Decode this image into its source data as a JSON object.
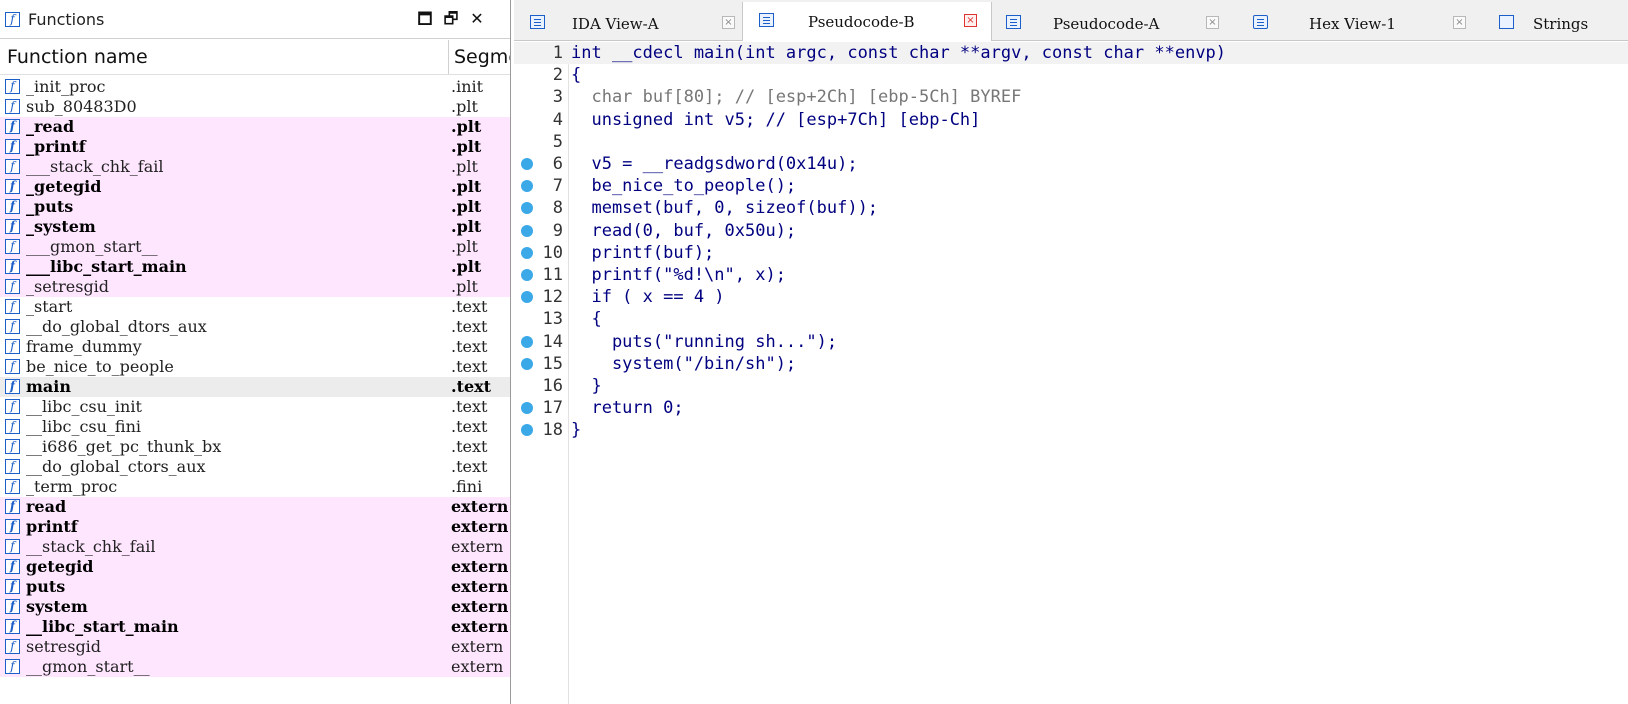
{
  "functions_window": {
    "title": "Functions",
    "buttons": {
      "maximize": "🗖",
      "restore": "🗗",
      "close": "✕"
    },
    "columns": {
      "name": "Function name",
      "segment": "Segment"
    },
    "rows": [
      {
        "name": "_init_proc",
        "segment": ".init",
        "style": "plain"
      },
      {
        "name": "sub_80483D0",
        "segment": ".plt",
        "style": "plain"
      },
      {
        "name": "_read",
        "segment": ".plt",
        "style": "pink-bold"
      },
      {
        "name": "_printf",
        "segment": ".plt",
        "style": "pink-bold"
      },
      {
        "name": "___stack_chk_fail",
        "segment": ".plt",
        "style": "pink"
      },
      {
        "name": "_getegid",
        "segment": ".plt",
        "style": "pink-bold"
      },
      {
        "name": "_puts",
        "segment": ".plt",
        "style": "pink-bold"
      },
      {
        "name": "_system",
        "segment": ".plt",
        "style": "pink-bold"
      },
      {
        "name": "___gmon_start__",
        "segment": ".plt",
        "style": "pink"
      },
      {
        "name": "___libc_start_main",
        "segment": ".plt",
        "style": "pink-bold"
      },
      {
        "name": "_setresgid",
        "segment": ".plt",
        "style": "pink"
      },
      {
        "name": "_start",
        "segment": ".text",
        "style": "plain"
      },
      {
        "name": "__do_global_dtors_aux",
        "segment": ".text",
        "style": "plain"
      },
      {
        "name": "frame_dummy",
        "segment": ".text",
        "style": "plain"
      },
      {
        "name": "be_nice_to_people",
        "segment": ".text",
        "style": "plain"
      },
      {
        "name": "main",
        "segment": ".text",
        "style": "selected-bold"
      },
      {
        "name": "__libc_csu_init",
        "segment": ".text",
        "style": "plain"
      },
      {
        "name": "__libc_csu_fini",
        "segment": ".text",
        "style": "plain"
      },
      {
        "name": "__i686_get_pc_thunk_bx",
        "segment": ".text",
        "style": "plain"
      },
      {
        "name": "__do_global_ctors_aux",
        "segment": ".text",
        "style": "plain"
      },
      {
        "name": "_term_proc",
        "segment": ".fini",
        "style": "plain"
      },
      {
        "name": "read",
        "segment": "extern",
        "style": "pink-bold"
      },
      {
        "name": "printf",
        "segment": "extern",
        "style": "pink-bold"
      },
      {
        "name": "__stack_chk_fail",
        "segment": "extern",
        "style": "pink"
      },
      {
        "name": "getegid",
        "segment": "extern",
        "style": "pink-bold"
      },
      {
        "name": "puts",
        "segment": "extern",
        "style": "pink-bold"
      },
      {
        "name": "system",
        "segment": "extern",
        "style": "pink-bold"
      },
      {
        "name": "__libc_start_main",
        "segment": "extern",
        "style": "pink-bold"
      },
      {
        "name": "setresgid",
        "segment": "extern",
        "style": "pink"
      },
      {
        "name": "__gmon_start__",
        "segment": "extern",
        "style": "pink"
      }
    ]
  },
  "tabs": [
    {
      "label": "IDA View-A",
      "icon": "disassembly-icon",
      "active": false,
      "close": "×"
    },
    {
      "label": "Pseudocode-B",
      "icon": "pseudocode-icon",
      "active": true,
      "close": "×"
    },
    {
      "label": "Pseudocode-A",
      "icon": "pseudocode-icon",
      "active": false,
      "close": "×"
    },
    {
      "label": "Hex View-1",
      "icon": "hex-icon",
      "active": false,
      "close": "×"
    },
    {
      "label": "Strings",
      "icon": "strings-icon",
      "active": false,
      "close": ""
    }
  ],
  "code": {
    "lines": [
      {
        "num": "1",
        "text": "int __cdecl main(int argc, const char **argv, const char **envp)",
        "dot": false
      },
      {
        "num": "2",
        "text": "{",
        "dot": false
      },
      {
        "num": "3",
        "text": "  char buf[80]; // [esp+2Ch] [ebp-5Ch] BYREF",
        "dot": false
      },
      {
        "num": "4",
        "text": "  unsigned int v5; // [esp+7Ch] [ebp-Ch]",
        "dot": false
      },
      {
        "num": "5",
        "text": "",
        "dot": false
      },
      {
        "num": "6",
        "text": "  v5 = __readgsdword(0x14u);",
        "dot": true
      },
      {
        "num": "7",
        "text": "  be_nice_to_people();",
        "dot": true
      },
      {
        "num": "8",
        "text": "  memset(buf, 0, sizeof(buf));",
        "dot": true
      },
      {
        "num": "9",
        "text": "  read(0, buf, 0x50u);",
        "dot": true
      },
      {
        "num": "10",
        "text": "  printf(buf);",
        "dot": true
      },
      {
        "num": "11",
        "text": "  printf(\"%d!\\n\", x);",
        "dot": true
      },
      {
        "num": "12",
        "text": "  if ( x == 4 )",
        "dot": true
      },
      {
        "num": "13",
        "text": "  {",
        "dot": false
      },
      {
        "num": "14",
        "text": "    puts(\"running sh...\");",
        "dot": true
      },
      {
        "num": "15",
        "text": "    system(\"/bin/sh\");",
        "dot": true
      },
      {
        "num": "16",
        "text": "  }",
        "dot": false
      },
      {
        "num": "17",
        "text": "  return 0;",
        "dot": true
      },
      {
        "num": "18",
        "text": "}",
        "dot": true
      }
    ]
  }
}
